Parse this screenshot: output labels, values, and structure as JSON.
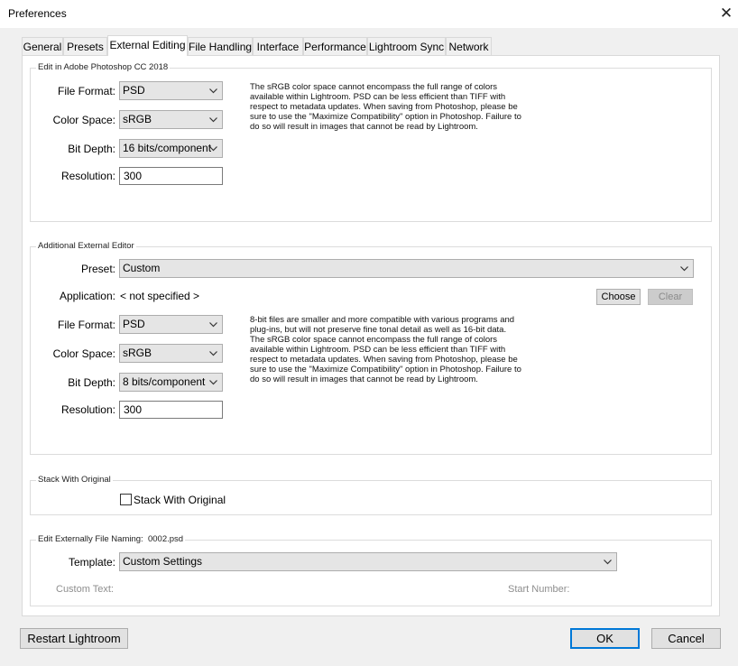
{
  "window": {
    "title": "Preferences"
  },
  "tabs": [
    {
      "label": "General"
    },
    {
      "label": "Presets"
    },
    {
      "label": "External Editing"
    },
    {
      "label": "File Handling"
    },
    {
      "label": "Interface"
    },
    {
      "label": "Performance"
    },
    {
      "label": "Lightroom Sync"
    },
    {
      "label": "Network"
    }
  ],
  "photoshop": {
    "legend": "Edit in Adobe Photoshop CC 2018",
    "file_format_label": "File Format:",
    "file_format": "PSD",
    "color_space_label": "Color Space:",
    "color_space": "sRGB",
    "bit_depth_label": "Bit Depth:",
    "bit_depth": "16 bits/component",
    "resolution_label": "Resolution:",
    "resolution": "300",
    "info": "The sRGB color space cannot encompass the full range of colors\navailable within Lightroom. PSD can be less efficient than TIFF with\nrespect to metadata updates. When saving from Photoshop, please be\nsure to use the \"Maximize Compatibility\" option in Photoshop. Failure to\ndo so will result in images that cannot be read by Lightroom."
  },
  "additional": {
    "legend": "Additional External Editor",
    "preset_label": "Preset:",
    "preset": "Custom",
    "application_label": "Application:",
    "application": "< not specified >",
    "choose_label": "Choose",
    "clear_label": "Clear",
    "file_format_label": "File Format:",
    "file_format": "PSD",
    "color_space_label": "Color Space:",
    "color_space": "sRGB",
    "bit_depth_label": "Bit Depth:",
    "bit_depth": "8 bits/component",
    "resolution_label": "Resolution:",
    "resolution": "300",
    "info": "8-bit files are smaller and more compatible with various programs and\nplug-ins, but will not preserve fine tonal detail as well as 16-bit data.\nThe sRGB color space cannot encompass the full range of colors\navailable within Lightroom. PSD can be less efficient than TIFF with\nrespect to metadata updates. When saving from Photoshop, please be\nsure to use the \"Maximize Compatibility\" option in Photoshop. Failure to\ndo so will result in images that cannot be read by Lightroom."
  },
  "stack": {
    "legend": "Stack With Original",
    "checkbox_label": "Stack With Original",
    "checked": false
  },
  "naming": {
    "legend": "Edit Externally File Naming:",
    "example": "0002.psd",
    "template_label": "Template:",
    "template": "Custom Settings",
    "custom_text_label": "Custom Text:",
    "start_number_label": "Start Number:"
  },
  "footer": {
    "restart_label": "Restart Lightroom",
    "ok_label": "OK",
    "cancel_label": "Cancel"
  },
  "colors": {
    "accent": "#0078d7",
    "background": "#f0f0f0",
    "panel": "#ffffff"
  }
}
